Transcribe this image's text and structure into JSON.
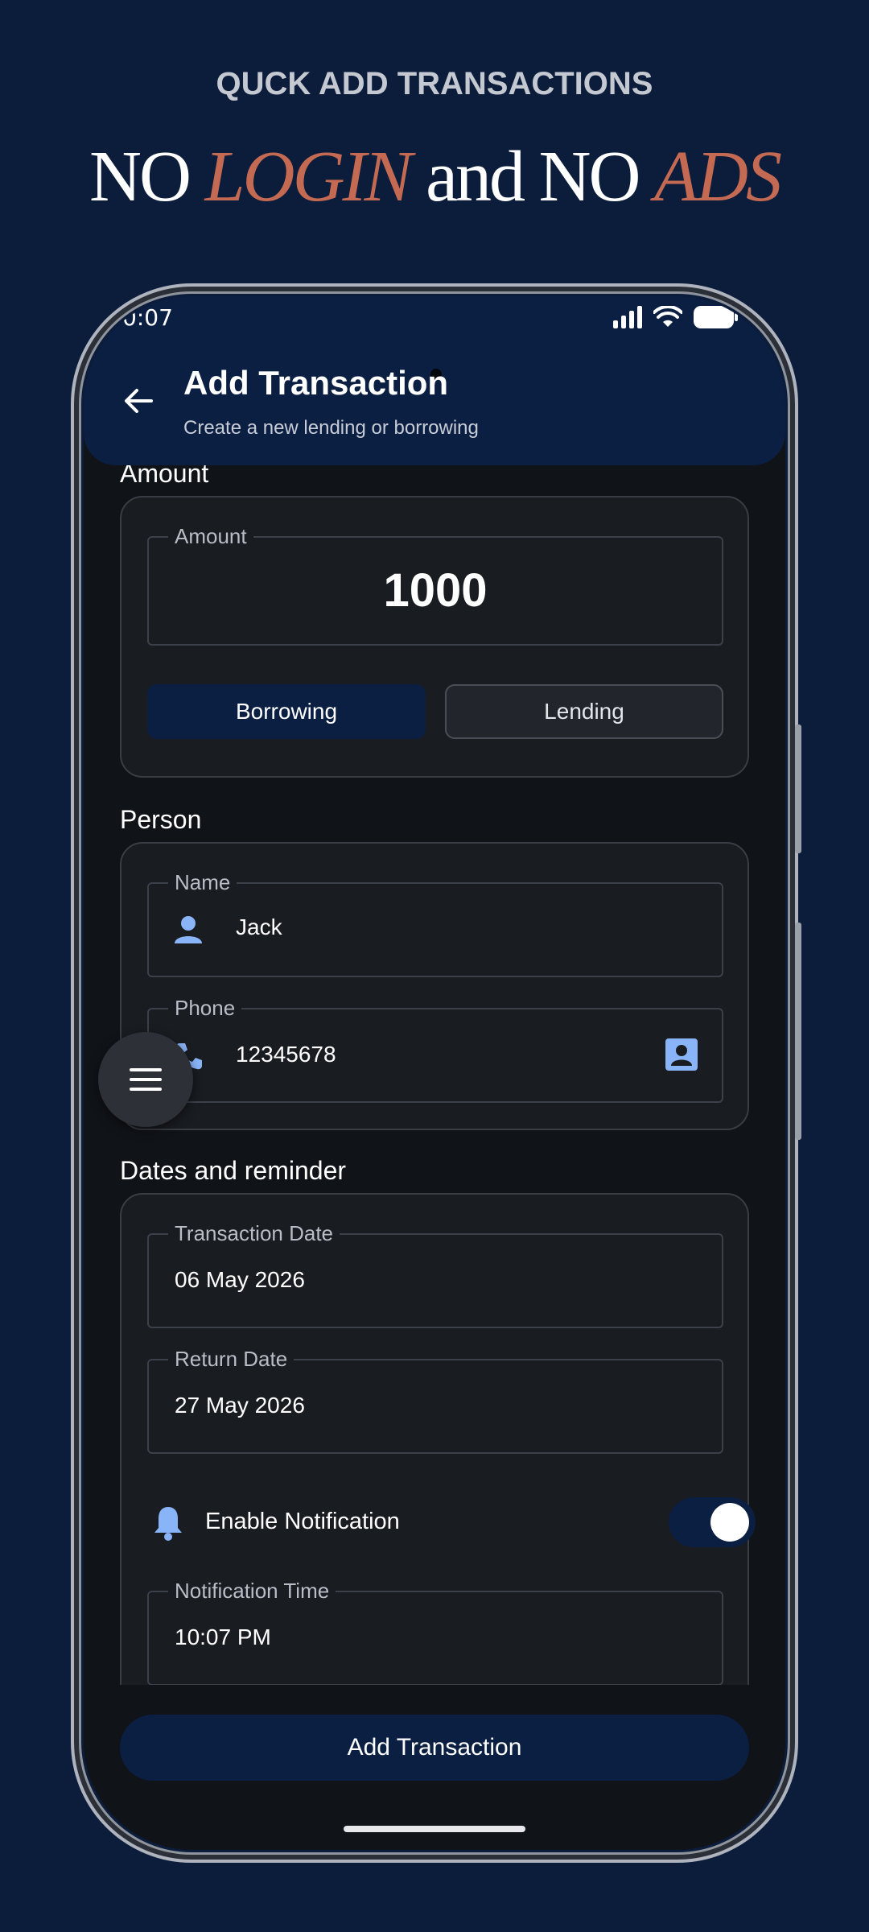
{
  "promo": {
    "subtitle": "QUCK ADD TRANSACTIONS",
    "title_part1": "NO ",
    "title_part2": "LOGIN",
    "title_part3": " and NO ",
    "title_part4": "ADS"
  },
  "status_bar": {
    "time": "0:07"
  },
  "header": {
    "title": "Add Transaction",
    "subtitle": "Create a new lending or borrowing"
  },
  "amount_section": {
    "title": "Amount",
    "field_label": "Amount",
    "value": "1000",
    "borrowing_label": "Borrowing",
    "lending_label": "Lending",
    "selected": "Borrowing"
  },
  "person_section": {
    "title": "Person",
    "name_label": "Name",
    "name_value": "Jack",
    "phone_label": "Phone",
    "phone_value": "12345678"
  },
  "dates_section": {
    "title": "Dates and reminder",
    "transaction_date_label": "Transaction Date",
    "transaction_date_value": "06 May 2026",
    "return_date_label": "Return Date",
    "return_date_value": "27 May 2026",
    "notification_label": "Enable Notification",
    "notification_enabled": true,
    "notification_time_label": "Notification Time",
    "notification_time_value": "10:07 PM"
  },
  "submit_label": "Add Transaction",
  "colors": {
    "background": "#0c1d3c",
    "accent": "#c46a53",
    "primary": "#0b1f43",
    "icon_blue": "#8ab4f8"
  }
}
